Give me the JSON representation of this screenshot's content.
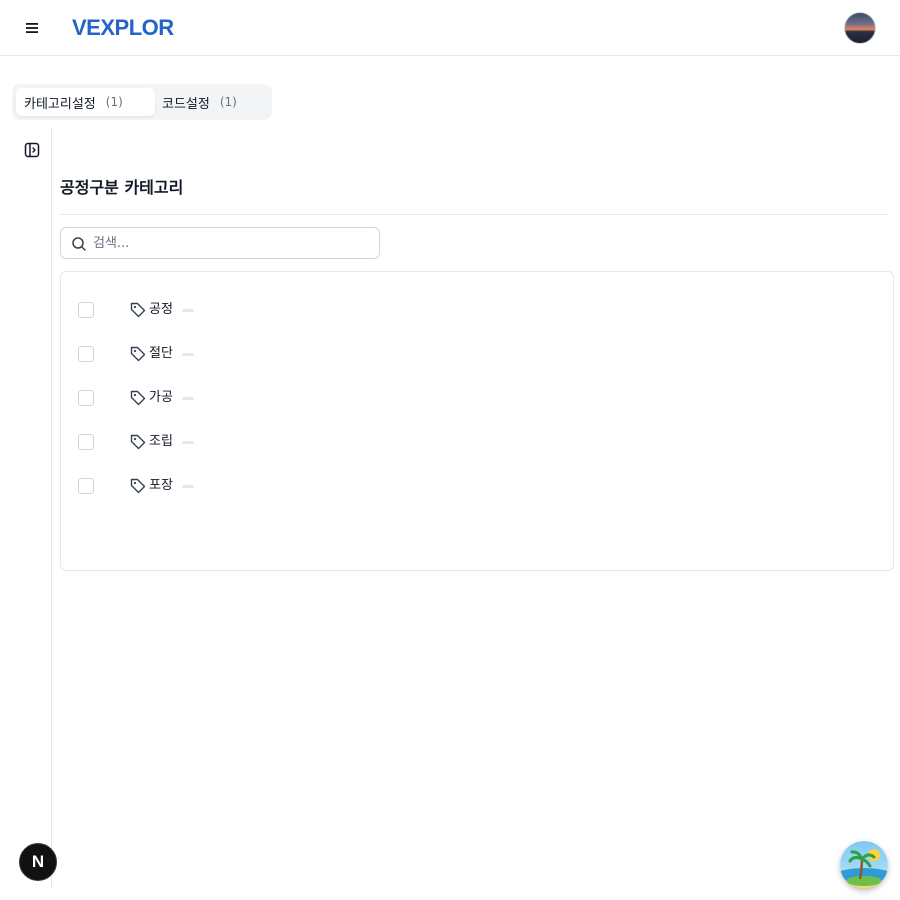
{
  "header": {
    "logo_text": "VEXPLOR",
    "icons": {
      "menu": "hamburger-menu-icon",
      "avatar": "user-avatar"
    }
  },
  "tabs": [
    {
      "label": "카테고리설정",
      "count": "(1)",
      "active": true
    },
    {
      "label": "코드설정",
      "count": "(1)",
      "active": false
    }
  ],
  "panel": {
    "title": "공정구분 카테고리",
    "search_placeholder": "검색...",
    "items": [
      {
        "label": "공정"
      },
      {
        "label": "절단"
      },
      {
        "label": "가공"
      },
      {
        "label": "조립"
      },
      {
        "label": "포장"
      }
    ]
  },
  "floating": {
    "left_button_label": "N",
    "right_button_icon": "beach-assistant-icon"
  },
  "colors": {
    "brand": "#2563c9",
    "border": "#e5e7eb",
    "tab_bg": "#f3f4f6"
  }
}
